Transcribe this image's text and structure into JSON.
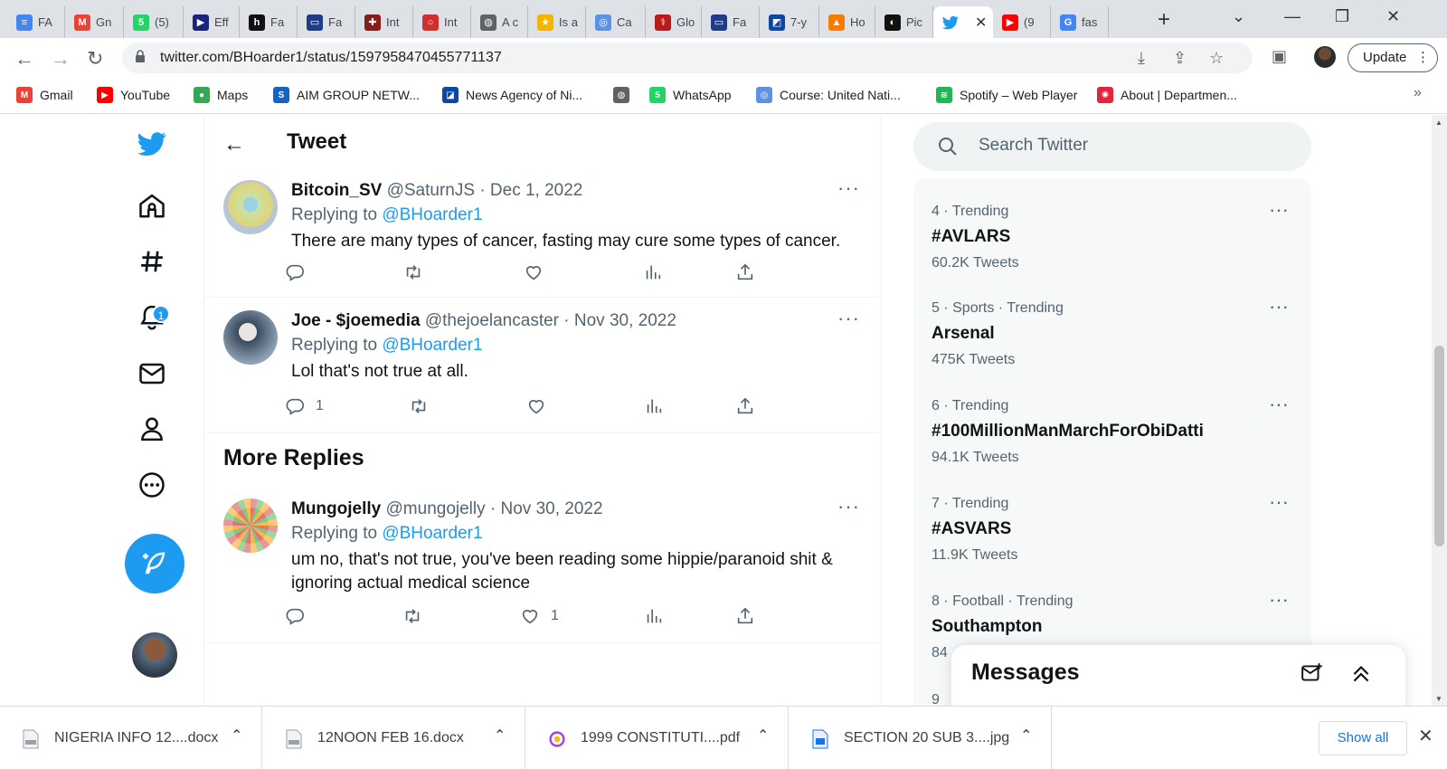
{
  "browser": {
    "tabs": [
      {
        "label": "FA",
        "icon": "google-docs-icon",
        "color": "#4285f4",
        "glyph": "≡"
      },
      {
        "label": "Gn",
        "icon": "gmail-icon",
        "color": "#ea4335",
        "glyph": "M"
      },
      {
        "label": "(5)",
        "icon": "whatsapp-icon",
        "color": "#25d366",
        "glyph": "5"
      },
      {
        "label": "Eff",
        "icon": "document-icon",
        "color": "#1a237e",
        "glyph": "▶"
      },
      {
        "label": "Fa",
        "icon": "h-logo-icon",
        "color": "#111111",
        "glyph": "h"
      },
      {
        "label": "Fa",
        "icon": "news-site-icon",
        "color": "#1f3c88",
        "glyph": "▭"
      },
      {
        "label": "Int",
        "icon": "medical-site-icon",
        "color": "#8b1a1a",
        "glyph": "✚"
      },
      {
        "label": "Int",
        "icon": "red-circle-icon",
        "color": "#d32f2f",
        "glyph": "○"
      },
      {
        "label": "A c",
        "icon": "globe-icon",
        "color": "#5f6368",
        "glyph": "◍"
      },
      {
        "label": "Is a",
        "icon": "star-icon",
        "color": "#f4b400",
        "glyph": "★"
      },
      {
        "label": "Ca",
        "icon": "who-icon",
        "color": "#5b92e5",
        "glyph": "◎"
      },
      {
        "label": "Glo",
        "icon": "caduceus-icon",
        "color": "#b71c1c",
        "glyph": "⚕"
      },
      {
        "label": "Fa",
        "icon": "news-site-icon",
        "color": "#1f3c88",
        "glyph": "▭"
      },
      {
        "label": "7-y",
        "icon": "report-icon",
        "color": "#0d47a1",
        "glyph": "◩"
      },
      {
        "label": "Ho",
        "icon": "orange-logo-icon",
        "color": "#f57c00",
        "glyph": "▲"
      },
      {
        "label": "Pic",
        "icon": "app-logo-icon",
        "color": "#111111",
        "glyph": "◐"
      },
      {
        "label": "",
        "icon": "twitter-bird-icon",
        "color": "#1d9bf0",
        "glyph": "",
        "active": true,
        "close": "✕"
      },
      {
        "label": "(9",
        "icon": "youtube-icon",
        "color": "#ff0000",
        "glyph": "▶"
      },
      {
        "label": "fas",
        "icon": "google-icon",
        "color": "#4285f4",
        "glyph": "G"
      }
    ],
    "url": "twitter.com/BHoarder1/status/1597958470455771137",
    "update_label": "Update",
    "bookmarks": [
      {
        "label": "Gmail",
        "icon": "gmail-icon",
        "color": "#ea4335",
        "glyph": "M"
      },
      {
        "label": "YouTube",
        "icon": "youtube-icon",
        "color": "#ff0000",
        "glyph": "▶"
      },
      {
        "label": "Maps",
        "icon": "maps-pin-icon",
        "color": "#34a853",
        "glyph": "●"
      },
      {
        "label": "AIM GROUP NETW...",
        "icon": "aim-group-icon",
        "color": "#1565c0",
        "glyph": "S"
      },
      {
        "label": "News Agency of Ni...",
        "icon": "nan-icon",
        "color": "#0d47a1",
        "glyph": "◪"
      },
      {
        "label": "",
        "icon": "globe-icon",
        "color": "#5f6368",
        "glyph": "◍"
      },
      {
        "label": "WhatsApp",
        "icon": "whatsapp-icon",
        "color": "#25d366",
        "glyph": "5"
      },
      {
        "label": "Course: United Nati...",
        "icon": "un-icon",
        "color": "#5b92e5",
        "glyph": "◎"
      },
      {
        "label": "Spotify – Web Player",
        "icon": "spotify-icon",
        "color": "#1db954",
        "glyph": "≋"
      },
      {
        "label": "About | Departmen...",
        "icon": "sdg-wheel-icon",
        "color": "#e5243b",
        "glyph": "✺"
      }
    ]
  },
  "nav": {
    "notifications_count": "1"
  },
  "main": {
    "title": "Tweet",
    "more_replies": "More Replies",
    "replies": [
      {
        "name": "Bitcoin_SV",
        "meta": "@SaturnJS · Dec 1, 2022",
        "replying_prefix": "Replying to",
        "replying_to": "@BHoarder1",
        "text": "There are many types of cancer, fasting may cure some types of cancer.",
        "replies_count": "",
        "likes_count": ""
      },
      {
        "name": "Joe - $joemedia",
        "meta": "@thejoelancaster · Nov 30, 2022",
        "replying_prefix": "Replying to",
        "replying_to": "@BHoarder1",
        "text": "Lol that's not true at all.",
        "replies_count": "1",
        "likes_count": ""
      },
      {
        "name": "Mungojelly",
        "meta": "@mungojelly · Nov 30, 2022",
        "replying_prefix": "Replying to",
        "replying_to": "@BHoarder1",
        "text": "um no, that's not true, you've been reading some hippie/paranoid shit & ignoring actual medical science",
        "replies_count": "",
        "likes_count": "1"
      }
    ]
  },
  "sidebar": {
    "search_placeholder": "Search Twitter",
    "trends": [
      {
        "meta": "4 · Trending",
        "name": "#AVLARS",
        "count": "60.2K Tweets"
      },
      {
        "meta": "5 · Sports · Trending",
        "name": "Arsenal",
        "count": "475K Tweets"
      },
      {
        "meta": "6 · Trending",
        "name": "#100MillionManMarchForObiDatti",
        "count": "94.1K Tweets"
      },
      {
        "meta": "7 · Trending",
        "name": "#ASVARS",
        "count": "11.9K Tweets"
      },
      {
        "meta": "8 · Football · Trending",
        "name": "Southampton",
        "count": "84"
      }
    ],
    "partial_trend_meta": "9"
  },
  "messages": {
    "title": "Messages"
  },
  "downloads": {
    "items": [
      {
        "name": "NIGERIA INFO 12....docx",
        "icon": "docx-file-icon"
      },
      {
        "name": "12NOON FEB 16.docx",
        "icon": "docx-file-icon"
      },
      {
        "name": "1999 CONSTITUTI....pdf",
        "icon": "pdf-file-icon"
      },
      {
        "name": "SECTION 20 SUB 3....jpg",
        "icon": "image-file-icon"
      }
    ],
    "show_all": "Show all"
  },
  "colors": {
    "twitter_blue": "#1d9bf0",
    "text_primary": "#0f1419",
    "text_secondary": "#536471"
  }
}
